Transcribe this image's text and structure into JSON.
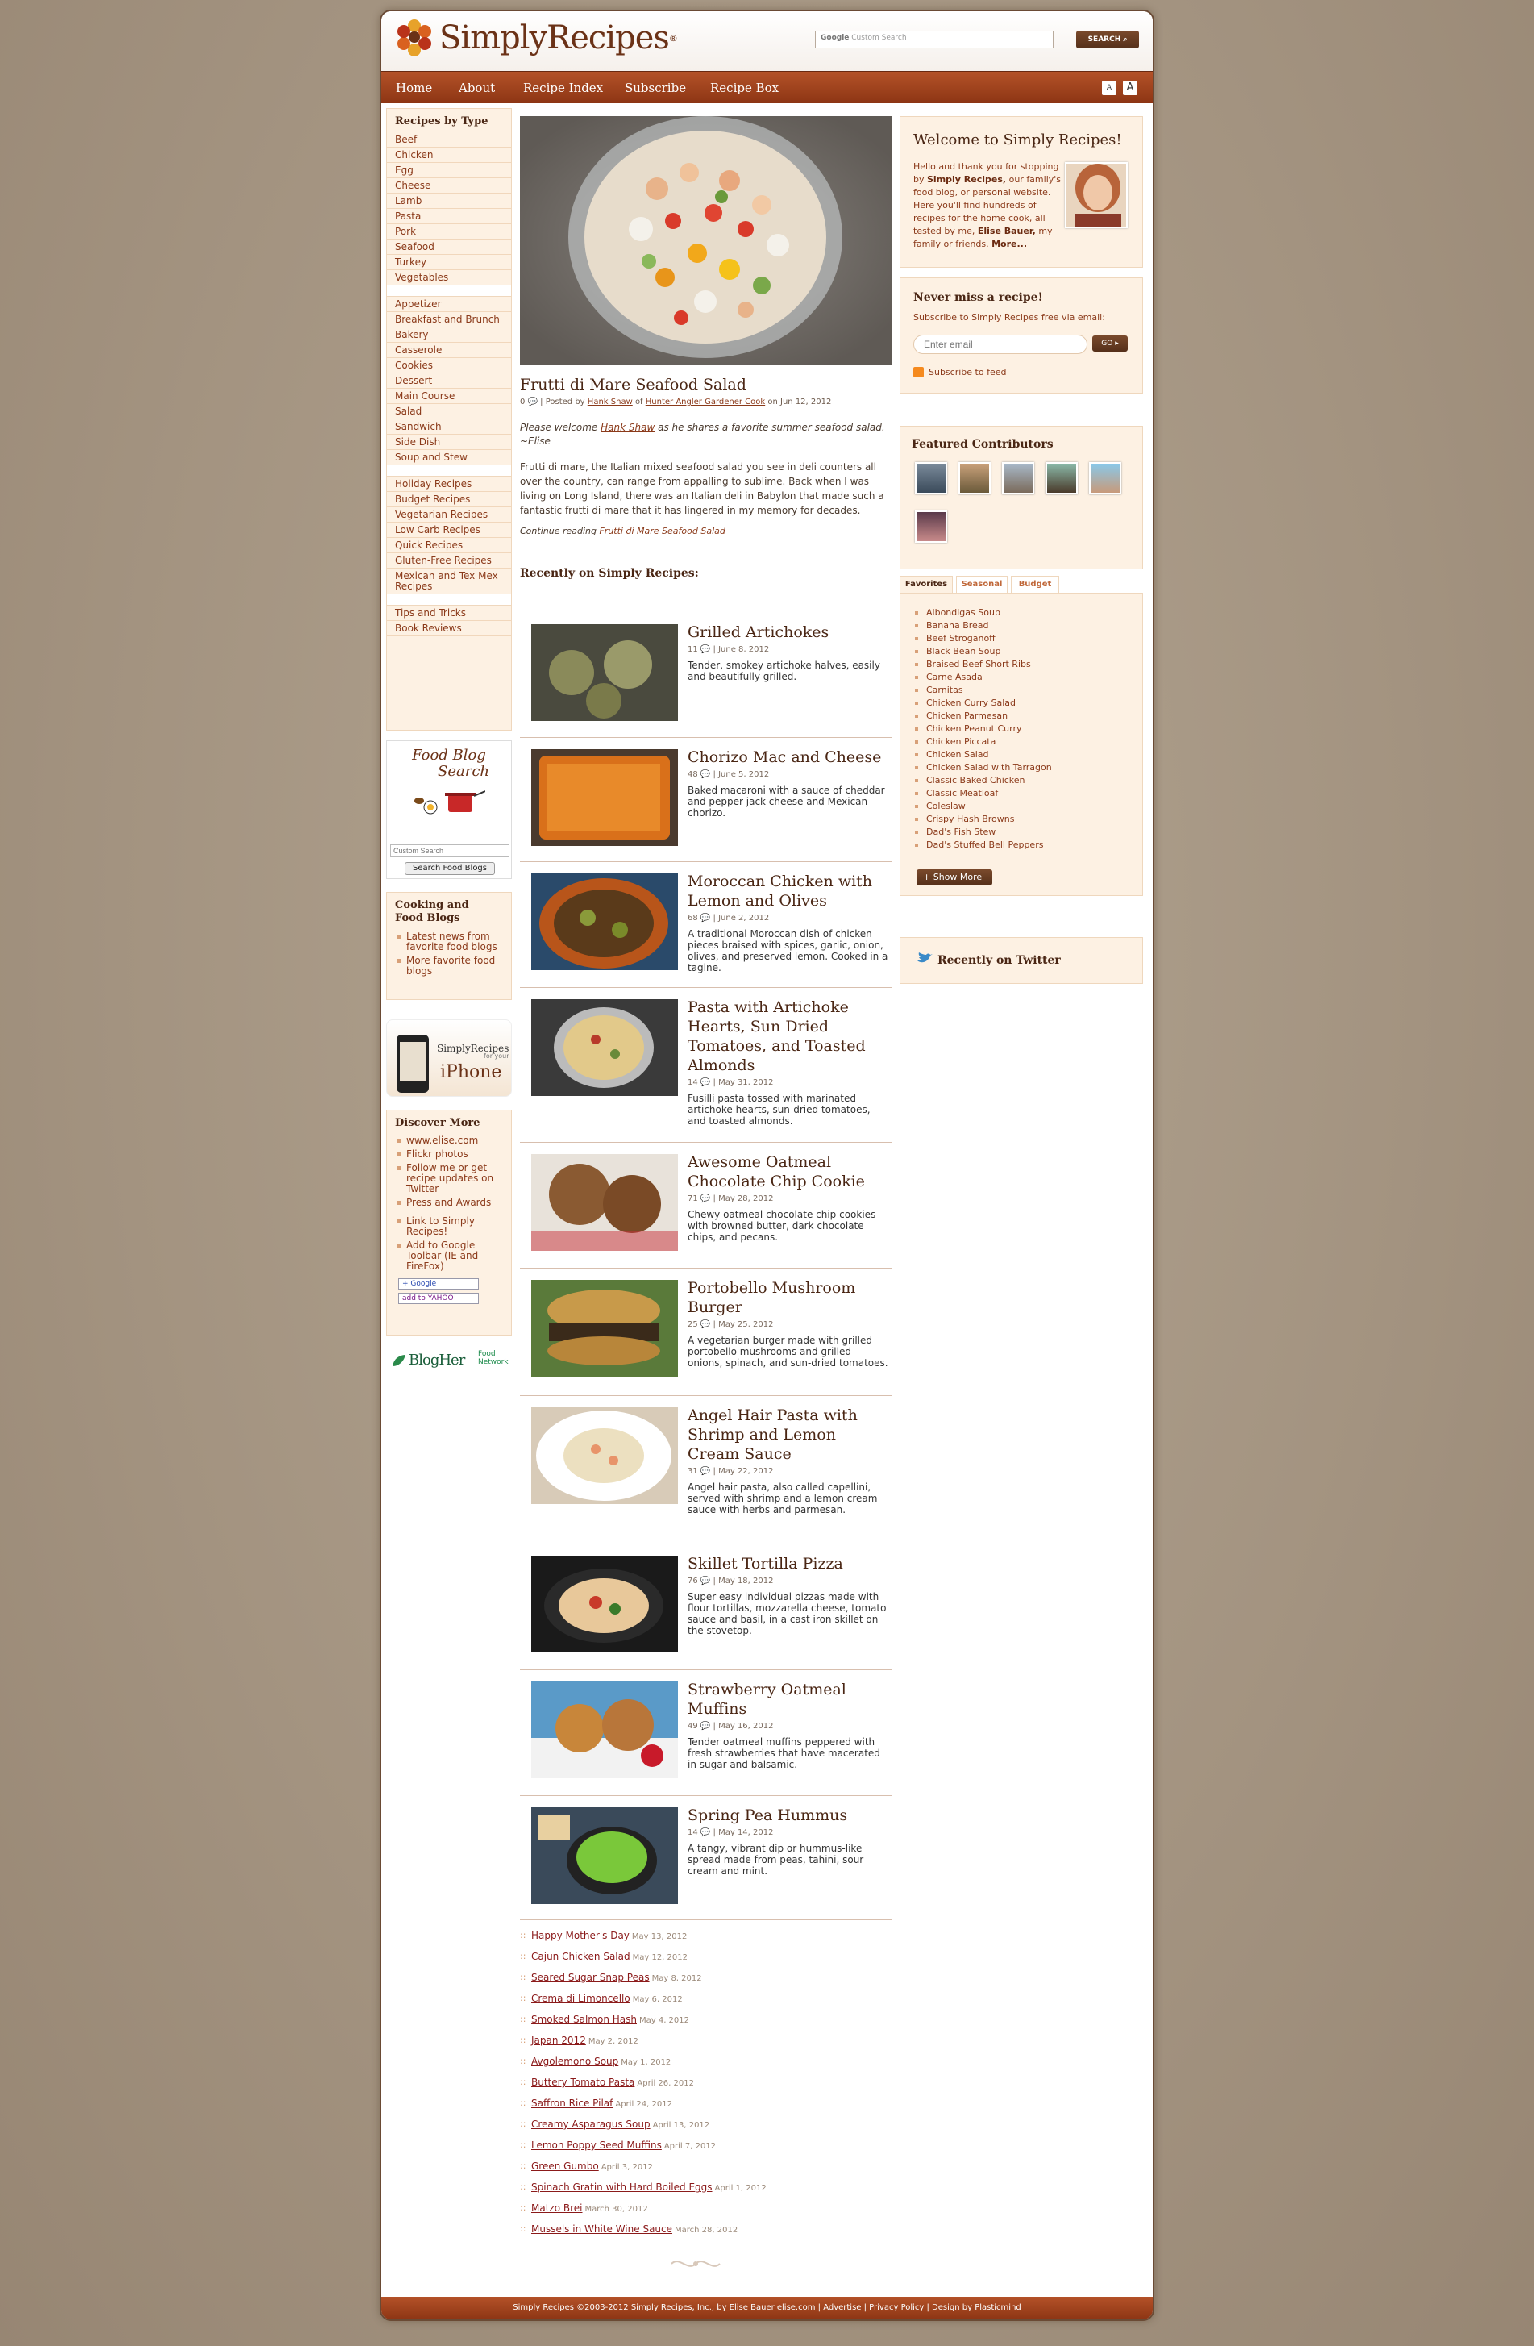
{
  "header": {
    "logo_text": "SimplyRecipes",
    "search_placeholder": "Custom Search",
    "search_brand": "Google",
    "search_button": "SEARCH"
  },
  "nav": {
    "items": [
      "Home",
      "About",
      "Recipe Index",
      "Subscribe",
      "Recipe Box"
    ],
    "font_small": "A",
    "font_large": "A"
  },
  "sidebar": {
    "recipes_by_type_title": "Recipes by Type",
    "types": [
      "Beef",
      "Chicken",
      "Egg",
      "Cheese",
      "Lamb",
      "Pasta",
      "Pork",
      "Seafood",
      "Turkey",
      "Vegetables"
    ],
    "courses": [
      "Appetizer",
      "Breakfast and Brunch",
      "Bakery",
      "Casserole",
      "Cookies",
      "Dessert",
      "Main Course",
      "Salad",
      "Sandwich",
      "Side Dish",
      "Soup and Stew"
    ],
    "special": [
      "Holiday Recipes",
      "Budget Recipes",
      "Vegetarian Recipes",
      "Low Carb Recipes",
      "Quick Recipes",
      "Gluten-Free Recipes",
      "Mexican and Tex Mex Recipes"
    ],
    "misc": [
      "Tips and Tricks",
      "Book Reviews"
    ],
    "food_blog_search": {
      "title_line1": "Food Blog",
      "title_line2": "Search",
      "input_placeholder": "Custom Search",
      "button": "Search Food Blogs"
    },
    "cooking_blogs": {
      "title": "Cooking and Food Blogs",
      "items": [
        "Latest news from favorite food blogs",
        "More favorite food blogs"
      ]
    },
    "iphone": {
      "line1": "SimplyRecipes",
      "line2": "for your",
      "line3": "iPhone"
    },
    "discover": {
      "title": "Discover More",
      "items": [
        "www.elise.com",
        "Flickr photos",
        "Follow me or get recipe updates on Twitter",
        "Press and Awards",
        "Link to Simply Recipes!",
        "Add to Google Toolbar (IE and FireFox)"
      ],
      "google_badge": "+ Google",
      "yahoo_badge": "add to YAHOO!"
    },
    "blogher": {
      "name": "BlogHer",
      "sub1": "Food",
      "sub2": "Network"
    }
  },
  "featured": {
    "title": "Frutti di Mare Seafood Salad",
    "comments": "0",
    "byline_posted": "Posted by",
    "author": "Hank Shaw",
    "of": "of",
    "site": "Hunter Angler Gardener Cook",
    "date": "on Jun 12, 2012",
    "intro_pre": "Please welcome",
    "intro_author": "Hank Shaw",
    "intro_post": "as he shares a favorite summer seafood salad. ~Elise",
    "body": "Frutti di mare, the Italian mixed seafood salad you see in deli counters all over the country, can range from appalling to sublime. Back when I was living on Long Island, there was an Italian deli in Babylon that made such a fantastic frutti di mare that it has lingered in my memory for decades.",
    "continue_pre": "Continue reading",
    "continue_link": "Frutti di Mare Seafood Salad"
  },
  "recent": {
    "heading": "Recently on Simply Recipes:",
    "posts": [
      {
        "title": "Grilled Artichokes",
        "comments": "11",
        "date": "June 8, 2012",
        "desc": "Tender, smokey artichoke halves, easily and beautifully grilled."
      },
      {
        "title": "Chorizo Mac and Cheese",
        "comments": "48",
        "date": "June 5, 2012",
        "desc": "Baked macaroni with a sauce of cheddar and pepper jack cheese and Mexican chorizo."
      },
      {
        "title": "Moroccan Chicken with Lemon and Olives",
        "comments": "68",
        "date": "June 2, 2012",
        "desc": "A traditional Moroccan dish of chicken pieces braised with spices, garlic, onion, olives, and preserved lemon. Cooked in a tagine."
      },
      {
        "title": "Pasta with Artichoke Hearts, Sun Dried Tomatoes, and Toasted Almonds",
        "comments": "14",
        "date": "May 31, 2012",
        "desc": "Fusilli pasta tossed with marinated artichoke hearts, sun-dried tomatoes, and toasted almonds."
      },
      {
        "title": "Awesome Oatmeal Chocolate Chip Cookie",
        "comments": "71",
        "date": "May 28, 2012",
        "desc": "Chewy oatmeal chocolate chip cookies with browned butter, dark chocolate chips, and pecans."
      },
      {
        "title": "Portobello Mushroom Burger",
        "comments": "25",
        "date": "May 25, 2012",
        "desc": "A vegetarian burger made with grilled portobello mushrooms and grilled onions, spinach, and sun-dried tomatoes."
      },
      {
        "title": "Angel Hair Pasta with Shrimp and Lemon Cream Sauce",
        "comments": "31",
        "date": "May 22, 2012",
        "desc": "Angel hair pasta, also called capellini, served with shrimp and a lemon cream sauce with herbs and parmesan."
      },
      {
        "title": "Skillet Tortilla Pizza",
        "comments": "76",
        "date": "May 18, 2012",
        "desc": "Super easy individual pizzas made with flour tortillas, mozzarella cheese, tomato sauce and basil, in a cast iron skillet on the stovetop."
      },
      {
        "title": "Strawberry Oatmeal Muffins",
        "comments": "49",
        "date": "May 16, 2012",
        "desc": "Tender oatmeal muffins peppered with fresh strawberries that have macerated in sugar and balsamic."
      },
      {
        "title": "Spring Pea Hummus",
        "comments": "14",
        "date": "May 14, 2012",
        "desc": "A tangy, vibrant dip or hummus-like spread made from peas, tahini, sour cream and mint."
      }
    ]
  },
  "older": [
    {
      "title": "Happy Mother's Day",
      "date": "May 13, 2012"
    },
    {
      "title": "Cajun Chicken Salad",
      "date": "May 12, 2012"
    },
    {
      "title": "Seared Sugar Snap Peas",
      "date": "May 8, 2012"
    },
    {
      "title": "Crema di Limoncello",
      "date": "May 6, 2012"
    },
    {
      "title": "Smoked Salmon Hash",
      "date": "May 4, 2012"
    },
    {
      "title": "Japan 2012",
      "date": "May 2, 2012"
    },
    {
      "title": "Avgolemono Soup",
      "date": "May 1, 2012"
    },
    {
      "title": "Buttery Tomato Pasta",
      "date": "April 26, 2012"
    },
    {
      "title": "Saffron Rice Pilaf",
      "date": "April 24, 2012"
    },
    {
      "title": "Creamy Asparagus Soup",
      "date": "April 13, 2012"
    },
    {
      "title": "Lemon Poppy Seed Muffins",
      "date": "April 7, 2012"
    },
    {
      "title": "Green Gumbo",
      "date": "April 3, 2012"
    },
    {
      "title": "Spinach Gratin with Hard Boiled Eggs",
      "date": "April 1, 2012"
    },
    {
      "title": "Matzo Brei",
      "date": "March 30, 2012"
    },
    {
      "title": "Mussels in White Wine Sauce",
      "date": "March 28, 2012"
    }
  ],
  "right": {
    "welcome": {
      "title": "Welcome to Simply Recipes!",
      "text_pre": "Hello and thank you for stopping by",
      "site_bold": "Simply Recipes,",
      "text_mid": "our family's food blog, or personal website. Here you'll find hundreds of recipes for the home cook, all tested by me,",
      "author_bold": "Elise Bauer,",
      "text_post": "my family or friends.",
      "more": "More..."
    },
    "never": {
      "title": "Never miss a recipe!",
      "sub": "Subscribe to Simply Recipes free via email:",
      "input_placeholder": "Enter email",
      "go": "GO",
      "feed": "Subscribe to feed"
    },
    "contributors_title": "Featured Contributors",
    "tabs": [
      "Favorites",
      "Seasonal",
      "Budget"
    ],
    "favorites": [
      "Albondigas Soup",
      "Banana Bread",
      "Beef Stroganoff",
      "Black Bean Soup",
      "Braised Beef Short Ribs",
      "Carne Asada",
      "Carnitas",
      "Chicken Curry Salad",
      "Chicken Parmesan",
      "Chicken Peanut Curry",
      "Chicken Piccata",
      "Chicken Salad",
      "Chicken Salad with Tarragon",
      "Classic Baked Chicken",
      "Classic Meatloaf",
      "Coleslaw",
      "Crispy Hash Browns",
      "Dad's Fish Stew",
      "Dad's Stuffed Bell Peppers"
    ],
    "show_more": "+ Show More",
    "twitter_title": "Recently on Twitter"
  },
  "footer": "Simply Recipes ©2003-2012 Simply Recipes, Inc., by Elise Bauer elise.com | Advertise | Privacy Policy | Design by Plasticmind",
  "colors": {
    "brand_brown": "#6b3217",
    "nav_rust": "#a8441c",
    "sidebar_bg": "#fdf1e3",
    "link": "#8b3a1a"
  }
}
